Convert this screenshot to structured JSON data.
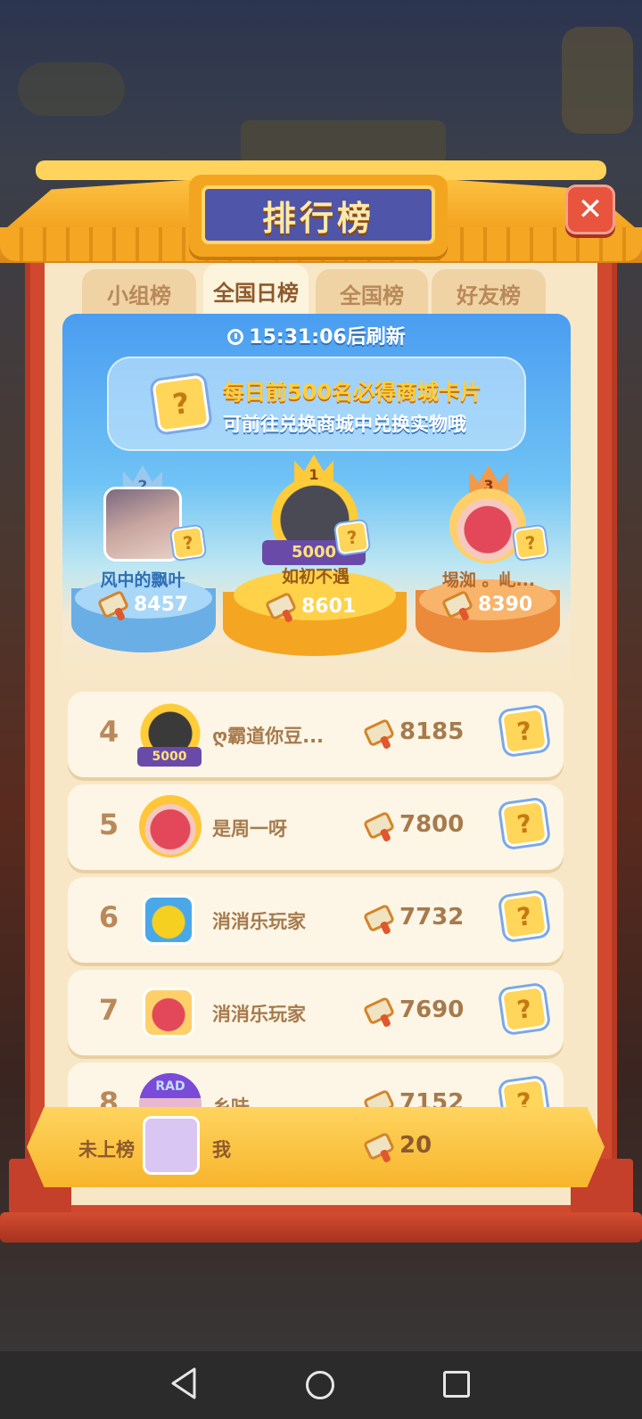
{
  "header": {
    "title": "排行榜",
    "close_symbol": "✕"
  },
  "tabs": [
    {
      "label": "小组榜",
      "active": false
    },
    {
      "label": "全国日榜",
      "active": true
    },
    {
      "label": "全国榜",
      "active": false
    },
    {
      "label": "好友榜",
      "active": false
    }
  ],
  "timer": {
    "text": "15:31:06后刷新"
  },
  "notice": {
    "line1": "每日前500名必得商城卡片",
    "line2": "可前往兑换商城中兑换实物哦"
  },
  "podium": [
    {
      "rank": "2",
      "name": "风中的飘叶",
      "score": "8457"
    },
    {
      "rank": "1",
      "name": "如初不遇",
      "score": "8601",
      "frame_badge": "5000"
    },
    {
      "rank": "3",
      "name": "埸洳 。乢...",
      "score": "8390"
    }
  ],
  "ranks": [
    {
      "rank": "4",
      "name": "ღ霸道你豆...",
      "score": "8185",
      "badge": "5000"
    },
    {
      "rank": "5",
      "name": "是周一呀",
      "score": "7800"
    },
    {
      "rank": "6",
      "name": "消消乐玩家",
      "score": "7732"
    },
    {
      "rank": "7",
      "name": "消消乐玩家",
      "score": "7690"
    },
    {
      "rank": "8",
      "name": "乡味",
      "score": "7152",
      "avatar_text": "RAD"
    }
  ],
  "self": {
    "status": "未上榜",
    "name": "我",
    "score": "20"
  },
  "card_symbol": "?",
  "colors": {
    "accent_gold": "#f7b52c",
    "frame_red": "#d0492f",
    "title_blue": "#4f55a8",
    "list_bg": "#fdf6e6"
  },
  "icons": {
    "score": "hammer-icon",
    "card": "mystery-card-icon",
    "timer": "clock-icon",
    "close": "close-icon"
  }
}
